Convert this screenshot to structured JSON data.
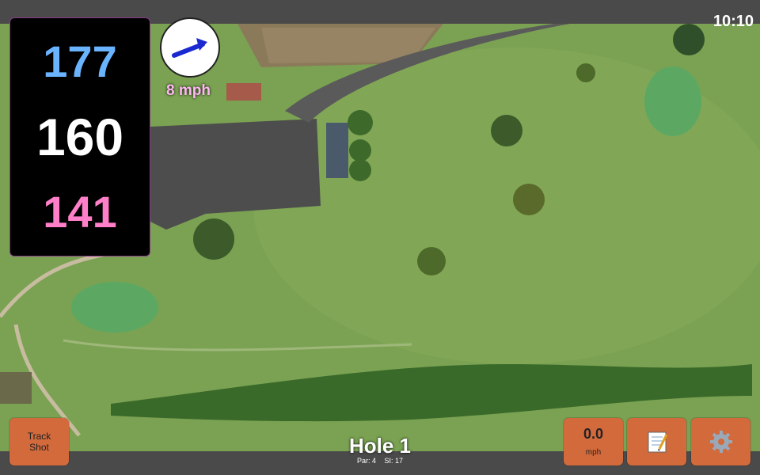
{
  "status_bar": {
    "time": "10:10"
  },
  "distances": {
    "back": "177",
    "middle": "160",
    "front": "141"
  },
  "wind": {
    "speed_label": "8 mph",
    "icon": "wind-arrow-icon"
  },
  "buttons": {
    "track_shot_line1": "Track",
    "track_shot_line2": "Shot",
    "speed_value": "0.0",
    "speed_unit": "mph",
    "notes_icon": "notepad-icon",
    "settings_icon": "gear-icon"
  },
  "hole": {
    "title": "Hole 1",
    "par": "Par: 4",
    "si": "SI: 17"
  },
  "colors": {
    "back_distance": "#6ab4ff",
    "middle_distance": "#ffffff",
    "front_distance": "#ff7fc9",
    "button_bg": "#d26a3c",
    "wind_label": "#ffb8f2"
  }
}
